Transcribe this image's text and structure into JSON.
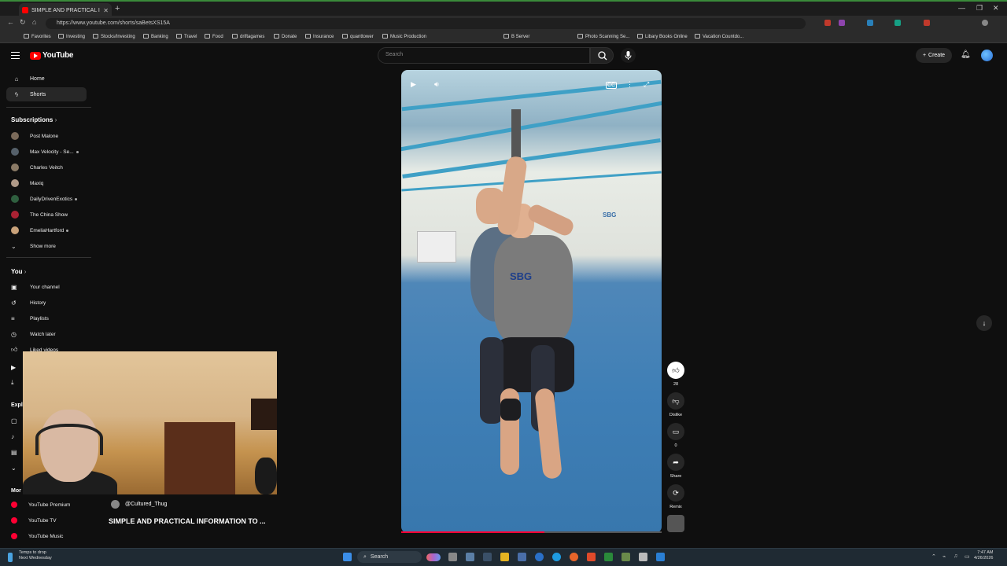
{
  "browser": {
    "tab_title": "SIMPLE AND PRACTICAL INFORMA",
    "new_tab": "+",
    "url": "https://www.youtube.com/shorts/saBetsXS15A",
    "bookmarks": [
      "Favorites",
      "Investing",
      "Stocks/Investing",
      "Banking",
      "Travel",
      "Food",
      "driftagames",
      "Donate",
      "Insurance",
      "quanttower",
      "Music Production",
      "B Server",
      "Photo Scanning Se...",
      "Libary Books Online",
      "Vacation Countdo..."
    ]
  },
  "header": {
    "logo": "YouTube",
    "search_placeholder": "Search",
    "create_label": "Create"
  },
  "sidebar": {
    "home": "Home",
    "shorts": "Shorts",
    "subscriptions_header": "Subscriptions",
    "subscriptions": [
      "Post Malone",
      "Max Velocity - Se...",
      "Charles Veitch",
      "Maxiq",
      "DailyDrivenExotics",
      "The China Show",
      "EmeliaHartford"
    ],
    "show_more": "Show more",
    "you_header": "You",
    "you_items": [
      "Your channel",
      "History",
      "Playlists",
      "Watch later",
      "Liked videos"
    ],
    "explore_header": "Expl",
    "more_header": "Mor",
    "more_items": [
      "YouTube Premium",
      "YouTube TV",
      "YouTube Music"
    ]
  },
  "video": {
    "channel": "@Cultured_Thug",
    "title": "SIMPLE AND PRACTICAL INFORMATION TO ...",
    "like_count": "28",
    "dislike_label": "Dislike",
    "comment_count": "0",
    "share_label": "Share",
    "remix_label": "Remix",
    "shirt_text": "SBG",
    "progress": 0.55
  },
  "taskbar": {
    "weather_line1": "Temps to drop",
    "weather_line2": "Next Wednesday",
    "search": "Search",
    "time": "7:47 AM",
    "date": "4/26/2026"
  },
  "colors": {
    "accent": "#ff0000",
    "background": "#0f0f0f"
  }
}
